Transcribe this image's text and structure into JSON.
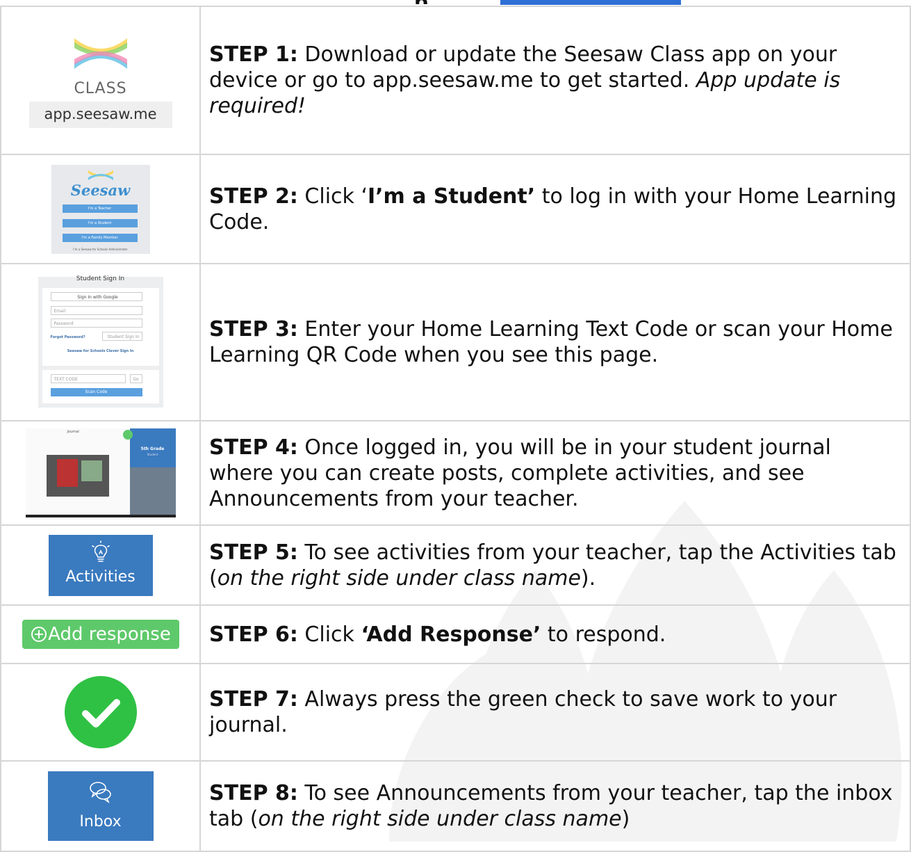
{
  "header": {
    "title_fragment": "p"
  },
  "steps": [
    {
      "image": {
        "icon": "seesaw-class-logo",
        "caption": "CLASS",
        "url": "app.seesaw.me"
      },
      "label": "STEP 1:",
      "text": "Download or update the Seesaw Class app on your device or go to app.seesaw.me to get started.",
      "italic": "App update is required!"
    },
    {
      "image": {
        "icon": "seesaw-login-screen",
        "brand": "Seesaw",
        "buttons": [
          "I'm a Teacher",
          "I'm a Student",
          "I'm a Family Member"
        ],
        "footer": "I'm a Seesaw for Schools Administrator"
      },
      "label": "STEP 2:",
      "text_before": "Click ‘",
      "bold": "I’m a Student’",
      "text_after": " to log in with your Home Learning Code."
    },
    {
      "image": {
        "icon": "student-sign-in-screen",
        "title": "Student Sign In",
        "google_button": "Sign In with Google",
        "email_placeholder": "Email",
        "password_placeholder": "Password",
        "forgot_link": "Forgot Password?",
        "signin_button": "Student Sign In",
        "clever_link": "Seesaw for Schools Clever Sign In",
        "code_placeholder": "TEXT CODE",
        "go_button": "Go",
        "scan_button": "Scan Code"
      },
      "label": "STEP 3:",
      "text": "Enter your Home Learning Text Code or scan your Home Learning QR Code when you see this page."
    },
    {
      "image": {
        "icon": "student-journal-screen",
        "class_name": "5th Grade",
        "role": "Student",
        "title": "Journal"
      },
      "label": "STEP 4:",
      "text": "Once logged in, you will be in your student journal where you can create posts, complete activities, and see Announcements from your teacher."
    },
    {
      "image": {
        "icon": "lightbulb-icon",
        "label": "Activities"
      },
      "label": "STEP 5:",
      "text_before": "To see activities from your teacher, tap the Activities tab (",
      "italic": "on the right side under class name",
      "text_after": ")."
    },
    {
      "image": {
        "icon": "plus-circle-icon",
        "label": "Add response"
      },
      "label": "STEP 6:",
      "text_before": "Click ",
      "bold": "‘Add Response’",
      "text_after": " to respond."
    },
    {
      "image": {
        "icon": "green-check-icon"
      },
      "label": "STEP 7:",
      "text": "Always press the green check to save work to your journal."
    },
    {
      "image": {
        "icon": "chat-bubbles-icon",
        "label": "Inbox"
      },
      "label": "STEP 8:",
      "text_before": "To see Announcements from your teacher, tap the inbox tab (",
      "italic": "on the right side under class name",
      "text_after": ")"
    }
  ],
  "colors": {
    "border": "#d6d6d6",
    "tab_blue": "#3a7abf",
    "check_green": "#2fc144",
    "add_green": "#5ec96a"
  }
}
